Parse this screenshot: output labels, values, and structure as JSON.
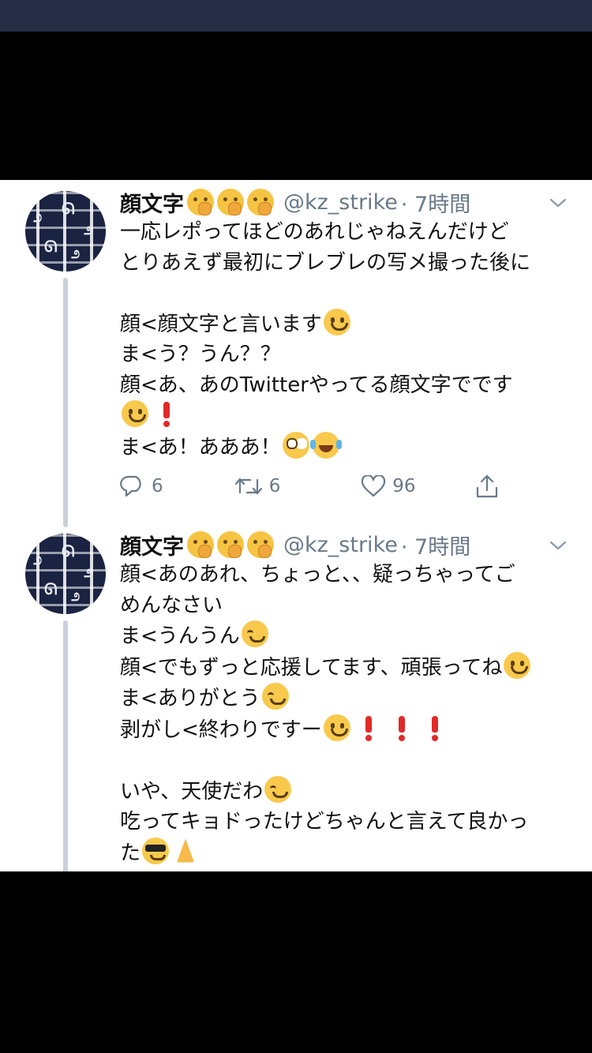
{
  "tweets": [
    {
      "display_name": "顔文字",
      "handle": "@kz_strike",
      "time": "· 7時間",
      "lines": [
        "一応レポってほどのあれじゃねえんだけど",
        "とりあえず最初にブレブレの写メ撮った後に",
        "",
        "顔<顔文字と言います",
        "ま<う？うん？？",
        "顔<あ、あのTwitterやってる顔文字でです",
        "",
        "ま<あ！あああ！"
      ],
      "actions": {
        "reply": "6",
        "retweet": "6",
        "like": "96"
      }
    },
    {
      "display_name": "顔文字",
      "handle": "@kz_strike",
      "time": "· 7時間",
      "lines": [
        "顔<あのあれ、ちょっと、、疑っちゃってご",
        "めんなさい",
        "ま<うんうん",
        "顔<でもずっと応援してます、頑張ってね",
        "ま<ありがとう",
        "剥がし<終わりですー",
        "",
        "いや、天使だわ",
        "吃ってキョドったけどちゃんと言えて良かっ",
        "た"
      ]
    }
  ],
  "icons": {
    "name_emoji": "face-with-hand-over-mouth-icon",
    "reply": "reply-icon",
    "retweet": "retweet-icon",
    "like": "heart-icon",
    "share": "share-icon",
    "more": "chevron-down-icon"
  },
  "colors": {
    "status_bar": "#242d44",
    "text": "#111111",
    "secondary": "#697a88",
    "thread_line": "#c9d1da"
  }
}
